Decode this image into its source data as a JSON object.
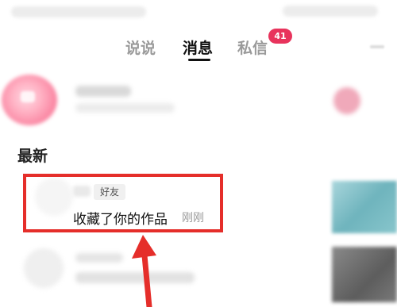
{
  "tabs": [
    {
      "label": "说说"
    },
    {
      "label": "消息"
    },
    {
      "label": "私信"
    }
  ],
  "active_tab": "消息",
  "private_message_badge": "41",
  "section": {
    "title": "最新"
  },
  "notification": {
    "tag": "好友",
    "action": "收藏了你的作品",
    "time": "刚刚"
  },
  "colors": {
    "highlight": "#e52e2a",
    "badge": "#e8335c",
    "active_tab": "#111111",
    "inactive_tab": "#9a9a9a"
  }
}
